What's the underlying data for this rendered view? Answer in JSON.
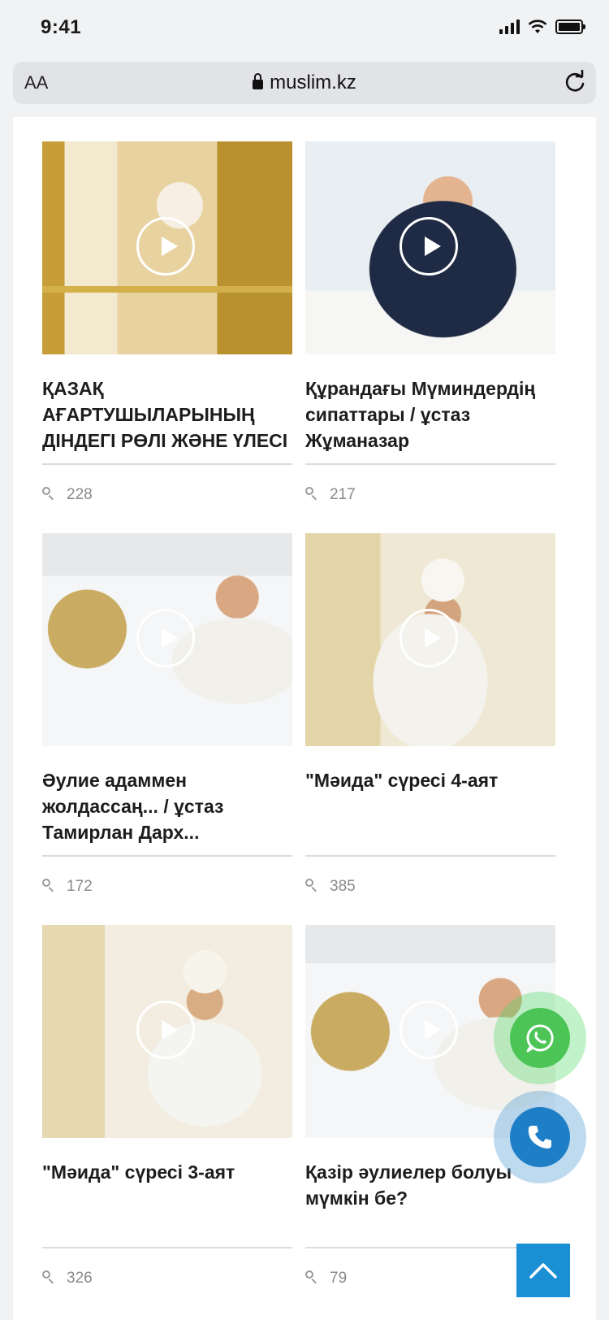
{
  "status_bar": {
    "time": "9:41",
    "icons": [
      "signal-icon",
      "wifi-icon",
      "battery-icon"
    ]
  },
  "browser": {
    "text_size_label": "AA",
    "url": "muslim.kz",
    "icons": [
      "lock-icon",
      "reload-icon"
    ]
  },
  "videos": [
    {
      "title": "ҚАЗАҚ АҒАРТУШЫЛАРЫНЫҢ ДІНДЕГІ РӨЛІ ЖӘНЕ ҮЛЕСІ",
      "views": "228"
    },
    {
      "title": "Құрандағы Мүминдердің сипаттары / ұстаз Жұманазар",
      "views": "217"
    },
    {
      "title": "Әулие адаммен жолдассаң... / ұстаз Тамирлан Дарх...",
      "views": "172"
    },
    {
      "title": "\"Мәида\" сүресі 4-аят",
      "views": "385"
    },
    {
      "title": "\"Мәида\" сүресі 3-аят",
      "views": "326"
    },
    {
      "title": "Қазір әулиелер болуы мүмкін бе?",
      "views": "79"
    }
  ],
  "floating_buttons": {
    "icons": [
      "whatsapp-icon",
      "phone-icon",
      "arrow-up-icon"
    ],
    "colors": {
      "whatsapp": "#4cc556",
      "phone": "#1e7fc7",
      "scroll_top": "#1a8fd4"
    }
  }
}
